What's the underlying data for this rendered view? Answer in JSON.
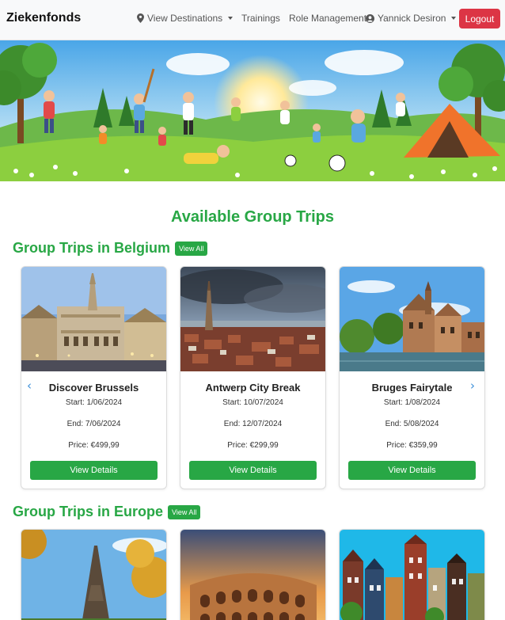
{
  "brand": "Ziekenfonds",
  "nav": {
    "destinations": "View Destinations",
    "trainings": "Trainings",
    "roles": "Role Management",
    "user": "Yannick Desiron",
    "logout": "Logout"
  },
  "page_title": "Available Group Trips",
  "sections": [
    {
      "title": "Group Trips in Belgium",
      "view_all": "View All",
      "trips": [
        {
          "name": "Discover Brussels",
          "start": "Start: 1/06/2024",
          "end": "End: 7/06/2024",
          "price": "Price: €499,99",
          "button": "View Details"
        },
        {
          "name": "Antwerp City Break",
          "start": "Start: 10/07/2024",
          "end": "End: 12/07/2024",
          "price": "Price: €299,99",
          "button": "View Details"
        },
        {
          "name": "Bruges Fairytale",
          "start": "Start: 1/08/2024",
          "end": "End: 5/08/2024",
          "price": "Price: €359,99",
          "button": "View Details"
        }
      ]
    },
    {
      "title": "Group Trips in Europe",
      "view_all": "View All"
    }
  ],
  "carousel": {
    "prev": "‹",
    "next": "›"
  },
  "colors": {
    "brand_green": "#28a745",
    "logout_red": "#dc3545",
    "accent_blue": "#3b8fd9"
  }
}
